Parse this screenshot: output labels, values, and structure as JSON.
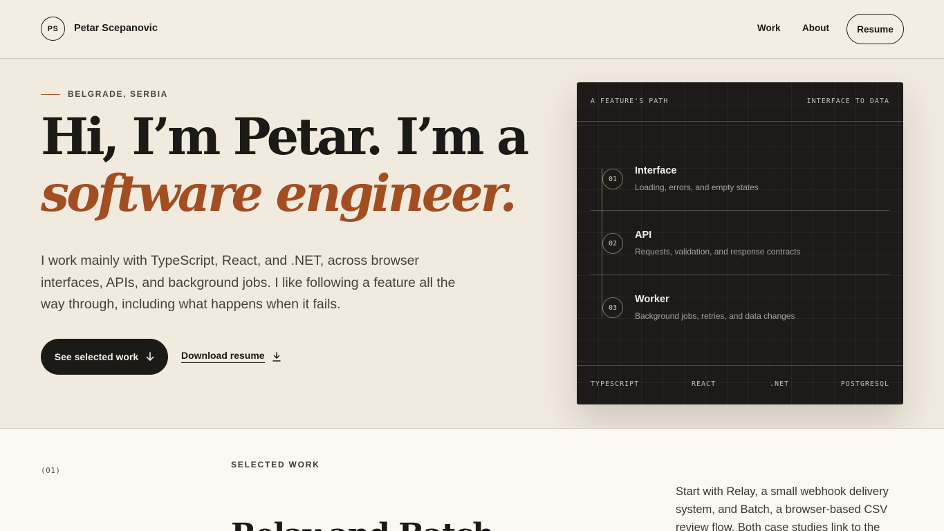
{
  "header": {
    "logo_initials": "PS",
    "brand_name": "Petar Scepanovic",
    "nav": [
      {
        "label": "Work"
      },
      {
        "label": "About"
      }
    ],
    "resume_label": "Resume"
  },
  "hero": {
    "location": "BELGRADE, SERBIA",
    "headline_line1": "Hi, I’m Petar. I’m a",
    "headline_line2": "software engineer.",
    "intro": "I work mainly with TypeScript, React, and .NET, across browser interfaces, APIs, and background jobs. I like following a feature all the way through, including what happens when it fails.",
    "primary_cta": "See selected work",
    "secondary_cta": "Download resume"
  },
  "card": {
    "top_left": "A FEATURE'S PATH",
    "top_right": "INTERFACE TO DATA",
    "steps": [
      {
        "num": "01",
        "title": "Interface",
        "desc": "Loading, errors, and empty states"
      },
      {
        "num": "02",
        "title": "API",
        "desc": "Requests, validation, and response contracts"
      },
      {
        "num": "03",
        "title": "Worker",
        "desc": "Background jobs, retries, and data changes"
      }
    ],
    "tech": [
      "TYPESCRIPT",
      "REACT",
      ".NET",
      "POSTGRESQL"
    ]
  },
  "section": {
    "index": "(01)",
    "label": "SELECTED WORK",
    "heading": "Relay and Batch",
    "copy": "Start with Relay, a small webhook delivery system, and Batch, a browser-based CSV review flow. Both case studies link to the"
  },
  "colors": {
    "background": "#f4ede3",
    "accent": "#a34e21",
    "ink": "#1b1a17",
    "card": "#1c1b19"
  }
}
